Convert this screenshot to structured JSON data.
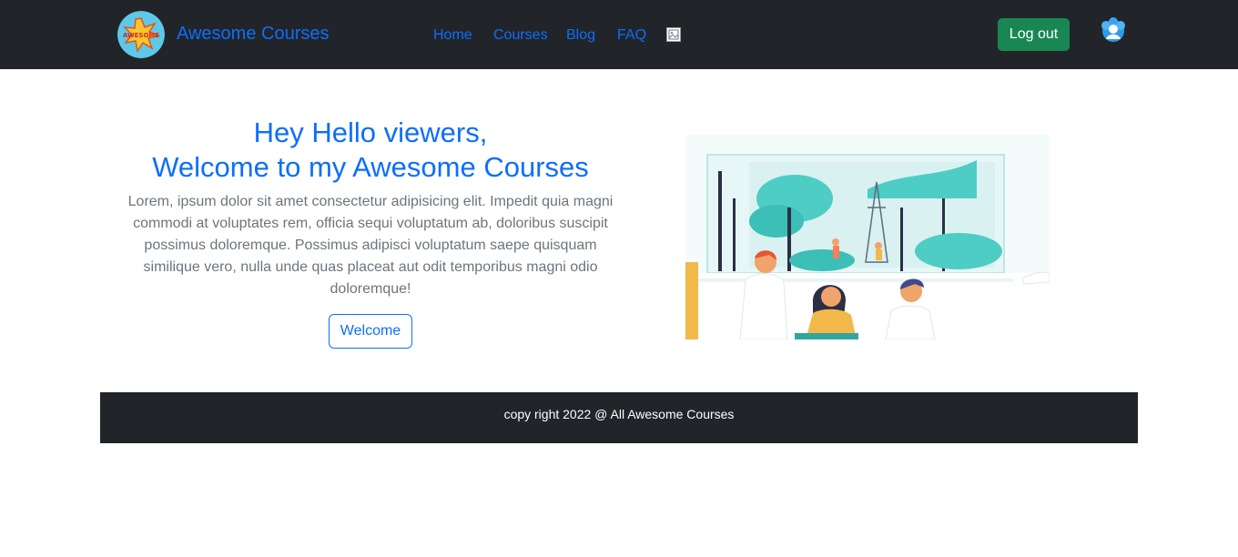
{
  "navbar": {
    "brand_logo_text": "AWESOME",
    "brand_name": "Awesome Courses",
    "links": [
      {
        "label": "Home"
      },
      {
        "label": "Courses"
      },
      {
        "label": "Blog"
      },
      {
        "label": "FAQ"
      }
    ],
    "broken_image_icon": "broken-image-icon",
    "logout_label": "Log out",
    "avatar_icon": "user-avatar-icon"
  },
  "hero": {
    "title_line1": "Hey Hello viewers,",
    "title_line2": "Welcome to my Awesome Courses",
    "description": "Lorem, ipsum dolor sit amet consectetur adipisicing elit. Impedit quia magni commodi at voluptates rem, officia sequi voluptatum ab, doloribus suscipit possimus doloremque. Possimus adipisci voluptatum saepe quisquam similique vero, nulla unde quas placeat aut odit temporibus magni odio doloremque!",
    "button_label": "Welcome"
  },
  "footer": {
    "text": "copy right 2022 @ All Awesome Courses"
  },
  "colors": {
    "navbar_bg": "#212529",
    "primary": "#0d6efd",
    "success": "#198754",
    "muted_text": "#6c757d",
    "illustration_teal": "#4ecdc4"
  }
}
